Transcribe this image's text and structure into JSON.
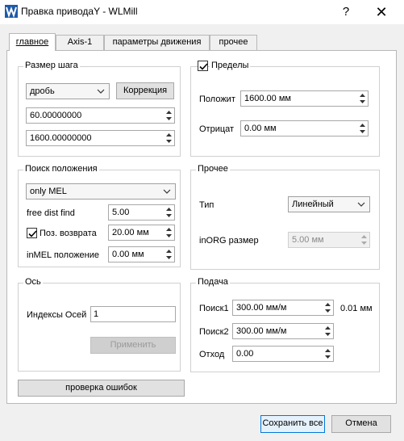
{
  "window": {
    "title": "Правка приводаY - WLMill",
    "help_glyph": "?",
    "close_glyph": "✕"
  },
  "tabs": [
    {
      "label": "главное"
    },
    {
      "label": "Axis-1"
    },
    {
      "label": "параметры движения"
    },
    {
      "label": "прочее"
    }
  ],
  "step": {
    "title": "Размер шага",
    "mode_value": "дробь",
    "correction_label": "Коррекция",
    "value1": "60.00000000",
    "value2": "1600.00000000"
  },
  "limits": {
    "title": "Пределы",
    "checked": true,
    "positive_label": "Положит",
    "positive_value": "1600.00 мм",
    "negative_label": "Отрицат",
    "negative_value": "0.00 мм"
  },
  "search": {
    "title": "Поиск положения",
    "mode_value": "only MEL",
    "free_dist_label": "free dist find",
    "free_dist_value": "5.00",
    "return_label": "Поз. возврата",
    "return_checked": true,
    "return_value": "20.00 мм",
    "inmel_label": "inMEL положение",
    "inmel_value": "0.00 мм"
  },
  "other": {
    "title": "Прочее",
    "type_label": "Тип",
    "type_value": "Линейный",
    "inorg_label": "inORG размер",
    "inorg_value": "5.00 мм"
  },
  "axis": {
    "title": "Ось",
    "indices_label": "Индексы Осей",
    "indices_value": "1",
    "apply_label": "Применить"
  },
  "feed": {
    "title": "Подача",
    "search1_label": "Поиск1",
    "search1_value": "300.00 мм/м",
    "search1_extra": "0.01 мм",
    "search2_label": "Поиск2",
    "search2_value": "300.00 мм/м",
    "retract_label": "Отход",
    "retract_value": "0.00"
  },
  "error_check_label": "проверка ошибок",
  "save_all_label": "Сохранить все",
  "cancel_label": "Отмена"
}
